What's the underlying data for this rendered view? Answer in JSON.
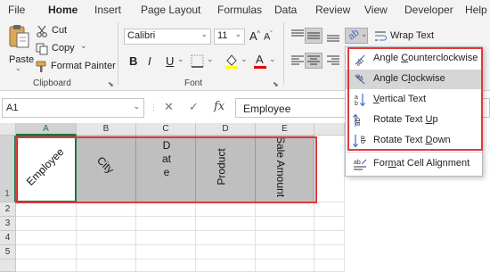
{
  "menu": {
    "tabs": [
      "File",
      "Home",
      "Insert",
      "Page Layout",
      "Formulas",
      "Data",
      "Review",
      "View",
      "Developer",
      "Help"
    ],
    "active": "Home"
  },
  "ribbon": {
    "clipboard": {
      "paste_label": "Paste",
      "cut_label": "Cut",
      "copy_label": "Copy",
      "format_painter_label": "Format Painter",
      "group_label": "Clipboard"
    },
    "font": {
      "font_name": "Calibri",
      "font_size": "11",
      "bold": "B",
      "italic": "I",
      "underline": "U",
      "grow_font": "A",
      "shrink_font": "A",
      "fill_letter": "A",
      "group_label": "Font",
      "fill_color": "#ffff00",
      "font_color": "#e0000b"
    },
    "alignment": {
      "wrap_text_label": "Wrap Text"
    }
  },
  "formula_bar": {
    "name_box": "A1",
    "cancel_symbol": "✕",
    "enter_symbol": "✓",
    "function_symbol": "fx",
    "formula": "Employee"
  },
  "sheet": {
    "columns": [
      "A",
      "B",
      "C",
      "D",
      "E"
    ],
    "rows": [
      "1",
      "2",
      "3",
      "4",
      "5"
    ],
    "row1": {
      "A": "Employee",
      "B": "City",
      "C": "Date",
      "D": "Product",
      "E": "Sale Amount"
    },
    "header_fill": "#bfbfbf",
    "highlight_color": "#e03a3a"
  },
  "orientation_menu": {
    "items": [
      {
        "prefix": "Angle ",
        "hotkey": "C",
        "suffix": "ounterclockwise",
        "icon": "angle-counterclockwise-icon"
      },
      {
        "prefix": "Angle C",
        "hotkey": "l",
        "suffix": "ockwise",
        "icon": "angle-clockwise-icon"
      },
      {
        "prefix": "",
        "hotkey": "V",
        "suffix": "ertical Text",
        "icon": "vertical-text-icon"
      },
      {
        "prefix": "Rotate Text ",
        "hotkey": "U",
        "suffix": "p",
        "icon": "rotate-text-up-icon"
      },
      {
        "prefix": "Rotate Text ",
        "hotkey": "D",
        "suffix": "own",
        "icon": "rotate-text-down-icon"
      },
      {
        "prefix": "For",
        "hotkey": "m",
        "suffix": "at Cell Alignment",
        "icon": "format-cell-alignment-icon"
      }
    ],
    "highlighted_index": 1
  }
}
